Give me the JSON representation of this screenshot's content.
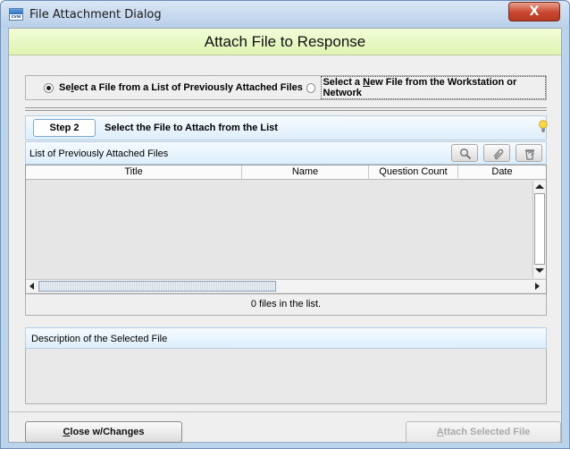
{
  "window": {
    "title": "File Attachment Dialog",
    "close_label": "X",
    "icon_text": "cvw"
  },
  "banner": {
    "title": "Attach File to Response"
  },
  "source_options": [
    {
      "label_pre": "Se",
      "label_ul": "l",
      "label_post": "ect a File from a List of Previously Attached Files",
      "selected": true
    },
    {
      "label_pre": "Select a ",
      "label_ul": "N",
      "label_post": "ew File from the Workstation or Network",
      "selected": false
    }
  ],
  "step": {
    "badge": "Step 2",
    "instruction": "Select the File to Attach from the List",
    "hint_icon": "lightbulb-icon"
  },
  "file_list": {
    "header": "List of Previously Attached Files",
    "tools": [
      "search-icon",
      "attachment-icon",
      "recycle-bin-icon"
    ],
    "columns": [
      "Title",
      "Name",
      "Question Count",
      "Date"
    ],
    "rows": [],
    "status": "0 files in the list."
  },
  "description": {
    "header": "Description of the Selected File",
    "text": ""
  },
  "buttons": {
    "close_ul": "C",
    "close_rest": "lose w/Changes",
    "attach_ul": "A",
    "attach_rest": "ttach Selected File"
  },
  "colors": {
    "banner_bg": "#dff4b2",
    "section_header_bg": "#ddeefb",
    "close_button": "#c8472e",
    "disabled_text": "#a9a9a9"
  }
}
